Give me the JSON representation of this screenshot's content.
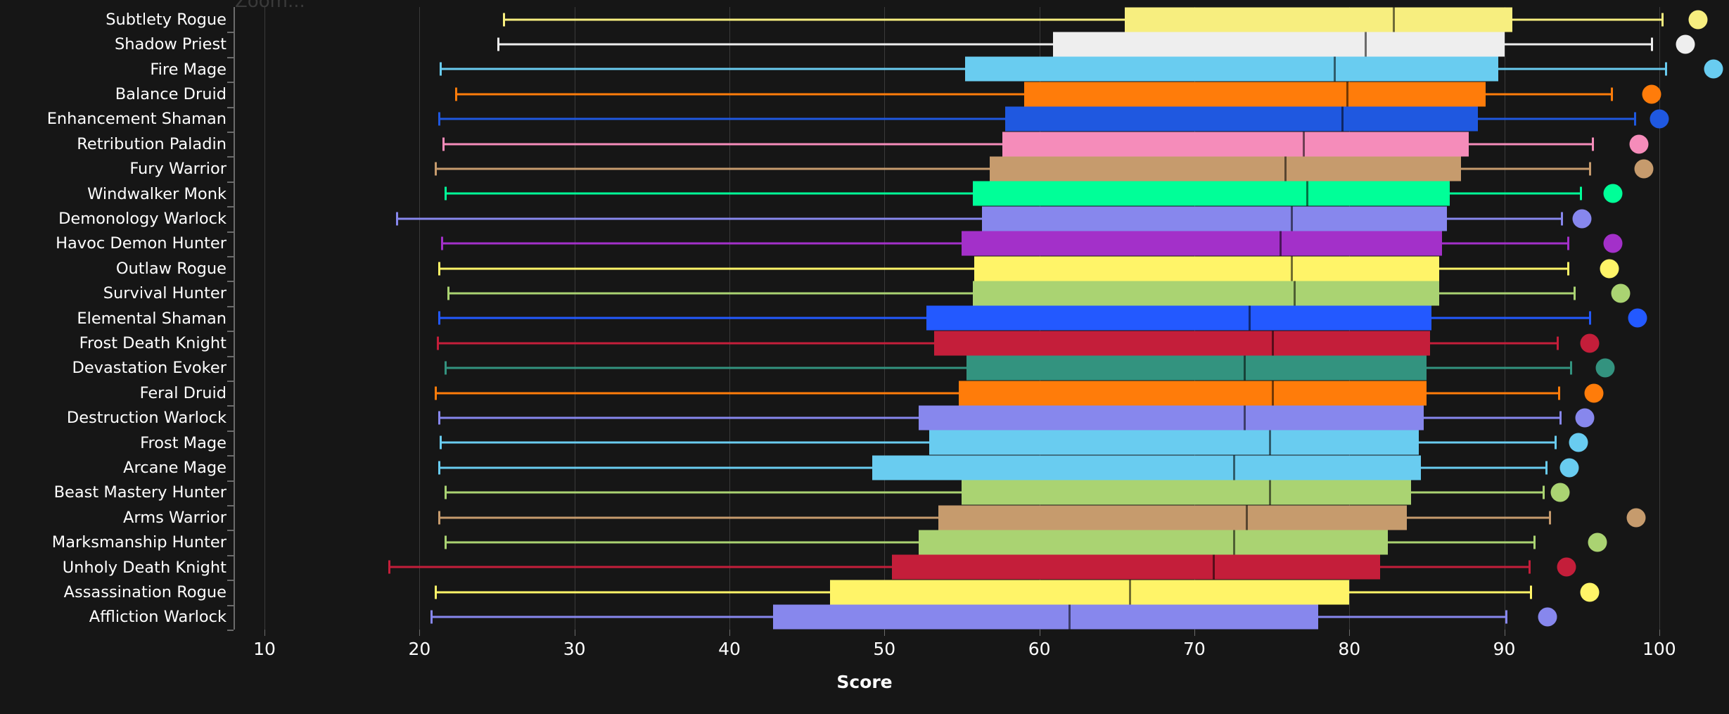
{
  "title_clipped": "Zoom...",
  "axis": {
    "x_label": "Score",
    "x_ticks": [
      10,
      20,
      30,
      40,
      50,
      60,
      70,
      80,
      90,
      100
    ],
    "x_min": 8.0,
    "x_max": 104.5
  },
  "chart_data": {
    "type": "box",
    "title": "",
    "xlabel": "Score",
    "ylabel": "",
    "xlim": [
      8.0,
      104.5
    ],
    "grid": true,
    "legend": "none",
    "orientation": "horizontal",
    "categories": [
      "Subtlety Rogue",
      "Shadow Priest",
      "Fire Mage",
      "Balance Druid",
      "Enhancement Shaman",
      "Retribution Paladin",
      "Fury Warrior",
      "Windwalker Monk",
      "Demonology Warlock",
      "Havoc Demon Hunter",
      "Outlaw Rogue",
      "Survival Hunter",
      "Elemental Shaman",
      "Frost Death Knight",
      "Devastation Evoker",
      "Feral Druid",
      "Destruction Warlock",
      "Frost Mage",
      "Arcane Mage",
      "Beast Mastery Hunter",
      "Arms Warrior",
      "Marksmanship Hunter",
      "Unholy Death Knight",
      "Assassination Rogue",
      "Affliction Warlock"
    ],
    "boxes": [
      {
        "label": "Subtlety Rogue",
        "color": "#F7EE7F",
        "whisker_low": 25.4,
        "q1": 65.5,
        "median": 82.8,
        "q3": 90.5,
        "whisker_high": 100.3,
        "outlier": 102.5
      },
      {
        "label": "Shadow Priest",
        "color": "#EEEEEE",
        "whisker_low": 25.0,
        "q1": 60.9,
        "median": 81.0,
        "q3": 90.0,
        "whisker_high": 99.6,
        "outlier": 101.7
      },
      {
        "label": "Fire Mage",
        "color": "#69CCF0",
        "whisker_low": 21.3,
        "q1": 55.2,
        "median": 79.0,
        "q3": 89.6,
        "whisker_high": 100.5,
        "outlier": 103.5
      },
      {
        "label": "Balance Druid",
        "color": "#FF7C0A",
        "whisker_low": 22.3,
        "q1": 59.0,
        "median": 79.8,
        "q3": 88.8,
        "whisker_high": 97.0,
        "outlier": 99.5
      },
      {
        "label": "Enhancement Shaman",
        "color": "#1F58E0",
        "whisker_low": 21.2,
        "q1": 57.8,
        "median": 79.5,
        "q3": 88.3,
        "whisker_high": 98.5,
        "outlier": 100.0
      },
      {
        "label": "Retribution Paladin",
        "color": "#F58CBA",
        "whisker_low": 21.5,
        "q1": 57.6,
        "median": 77.0,
        "q3": 87.7,
        "whisker_high": 95.8,
        "outlier": 98.7
      },
      {
        "label": "Fury Warrior",
        "color": "#C69B6D",
        "whisker_low": 21.0,
        "q1": 56.8,
        "median": 75.8,
        "q3": 87.2,
        "whisker_high": 95.6,
        "outlier": 99.0
      },
      {
        "label": "Windwalker Monk",
        "color": "#00FF98",
        "whisker_low": 21.6,
        "q1": 55.7,
        "median": 77.2,
        "q3": 86.5,
        "whisker_high": 95.0,
        "outlier": 97.0
      },
      {
        "label": "Demonology Warlock",
        "color": "#8787ED",
        "whisker_low": 18.5,
        "q1": 56.3,
        "median": 76.2,
        "q3": 86.3,
        "whisker_high": 93.8,
        "outlier": 95.0
      },
      {
        "label": "Havoc Demon Hunter",
        "color": "#A330C9",
        "whisker_low": 21.4,
        "q1": 55.0,
        "median": 75.5,
        "q3": 86.0,
        "whisker_high": 94.2,
        "outlier": 97.0
      },
      {
        "label": "Outlaw Rogue",
        "color": "#FFF468",
        "whisker_low": 21.2,
        "q1": 55.8,
        "median": 76.2,
        "q3": 85.8,
        "whisker_high": 94.2,
        "outlier": 96.8
      },
      {
        "label": "Survival Hunter",
        "color": "#AAD372",
        "whisker_low": 21.8,
        "q1": 55.7,
        "median": 76.4,
        "q3": 85.8,
        "whisker_high": 94.6,
        "outlier": 97.5
      },
      {
        "label": "Elemental Shaman",
        "color": "#2359FF",
        "whisker_low": 21.2,
        "q1": 52.7,
        "median": 73.5,
        "q3": 85.3,
        "whisker_high": 95.6,
        "outlier": 98.6
      },
      {
        "label": "Frost Death Knight",
        "color": "#C41E3A",
        "whisker_low": 21.1,
        "q1": 53.2,
        "median": 75.0,
        "q3": 85.2,
        "whisker_high": 93.5,
        "outlier": 95.5
      },
      {
        "label": "Devastation Evoker",
        "color": "#33937F",
        "whisker_low": 21.6,
        "q1": 55.3,
        "median": 73.2,
        "q3": 85.0,
        "whisker_high": 94.4,
        "outlier": 96.5
      },
      {
        "label": "Feral Druid",
        "color": "#FF7C0A",
        "whisker_low": 21.0,
        "q1": 54.8,
        "median": 75.0,
        "q3": 85.0,
        "whisker_high": 93.6,
        "outlier": 95.8
      },
      {
        "label": "Destruction Warlock",
        "color": "#8787ED",
        "whisker_low": 21.2,
        "q1": 52.2,
        "median": 73.2,
        "q3": 84.8,
        "whisker_high": 93.7,
        "outlier": 95.2
      },
      {
        "label": "Frost Mage",
        "color": "#69CCF0",
        "whisker_low": 21.3,
        "q1": 52.9,
        "median": 74.8,
        "q3": 84.5,
        "whisker_high": 93.4,
        "outlier": 94.8
      },
      {
        "label": "Arcane Mage",
        "color": "#69CCF0",
        "whisker_low": 21.2,
        "q1": 49.2,
        "median": 72.5,
        "q3": 84.6,
        "whisker_high": 92.8,
        "outlier": 94.2
      },
      {
        "label": "Beast Mastery Hunter",
        "color": "#AAD372",
        "whisker_low": 21.6,
        "q1": 55.0,
        "median": 74.8,
        "q3": 84.0,
        "whisker_high": 92.6,
        "outlier": 93.6
      },
      {
        "label": "Arms Warrior",
        "color": "#C69B6D",
        "whisker_low": 21.2,
        "q1": 53.5,
        "median": 73.3,
        "q3": 83.7,
        "whisker_high": 93.0,
        "outlier": 98.5
      },
      {
        "label": "Marksmanship Hunter",
        "color": "#AAD372",
        "whisker_low": 21.6,
        "q1": 52.2,
        "median": 72.5,
        "q3": 82.5,
        "whisker_high": 92.0,
        "outlier": 96.0
      },
      {
        "label": "Unholy Death Knight",
        "color": "#C41E3A",
        "whisker_low": 18.0,
        "q1": 50.5,
        "median": 71.2,
        "q3": 82.0,
        "whisker_high": 91.7,
        "outlier": 94.0
      },
      {
        "label": "Assassination Rogue",
        "color": "#FFF468",
        "whisker_low": 21.0,
        "q1": 46.5,
        "median": 65.8,
        "q3": 80.0,
        "whisker_high": 91.8,
        "outlier": 95.5
      },
      {
        "label": "Affliction Warlock",
        "color": "#8787ED",
        "whisker_low": 20.7,
        "q1": 42.8,
        "median": 61.9,
        "q3": 78.0,
        "whisker_high": 90.2,
        "outlier": 92.8
      }
    ]
  }
}
